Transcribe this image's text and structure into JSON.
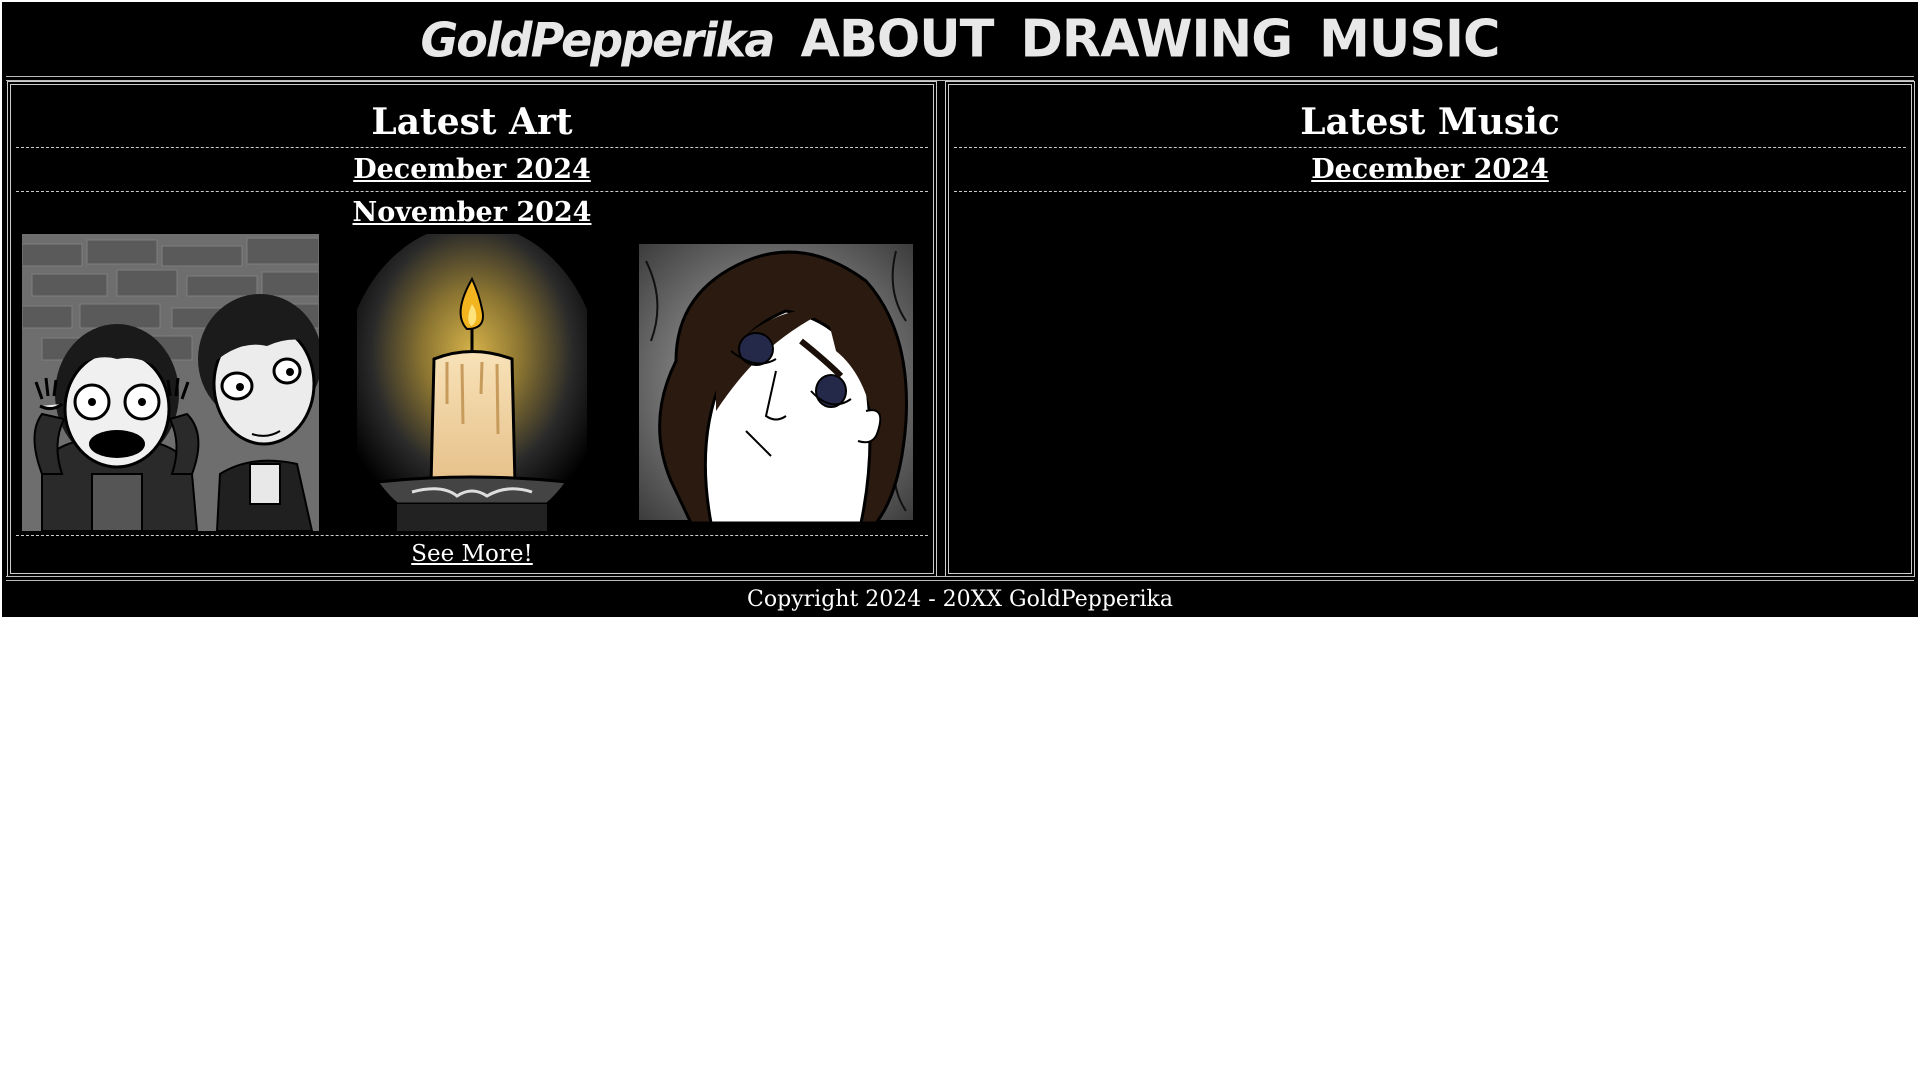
{
  "header": {
    "nav": [
      {
        "label": "GoldPepperika"
      },
      {
        "label": "ABOUT"
      },
      {
        "label": "DRAWING"
      },
      {
        "label": "MUSIC"
      }
    ]
  },
  "art": {
    "title": "Latest Art",
    "months": [
      "December 2024",
      "November 2024"
    ],
    "thumbnails": [
      {
        "icon": "two-characters-scared-drawing"
      },
      {
        "icon": "lit-candle-drawing"
      },
      {
        "icon": "tired-girl-portrait-drawing"
      }
    ],
    "see_more": "See More!"
  },
  "music": {
    "title": "Latest Music",
    "months": [
      "December 2024"
    ]
  },
  "footer": {
    "copyright": "Copyright 2024 - 20XX GoldPepperika"
  },
  "colors": {
    "background": "#000000",
    "text": "#ffffff",
    "border": "#cccccc"
  }
}
